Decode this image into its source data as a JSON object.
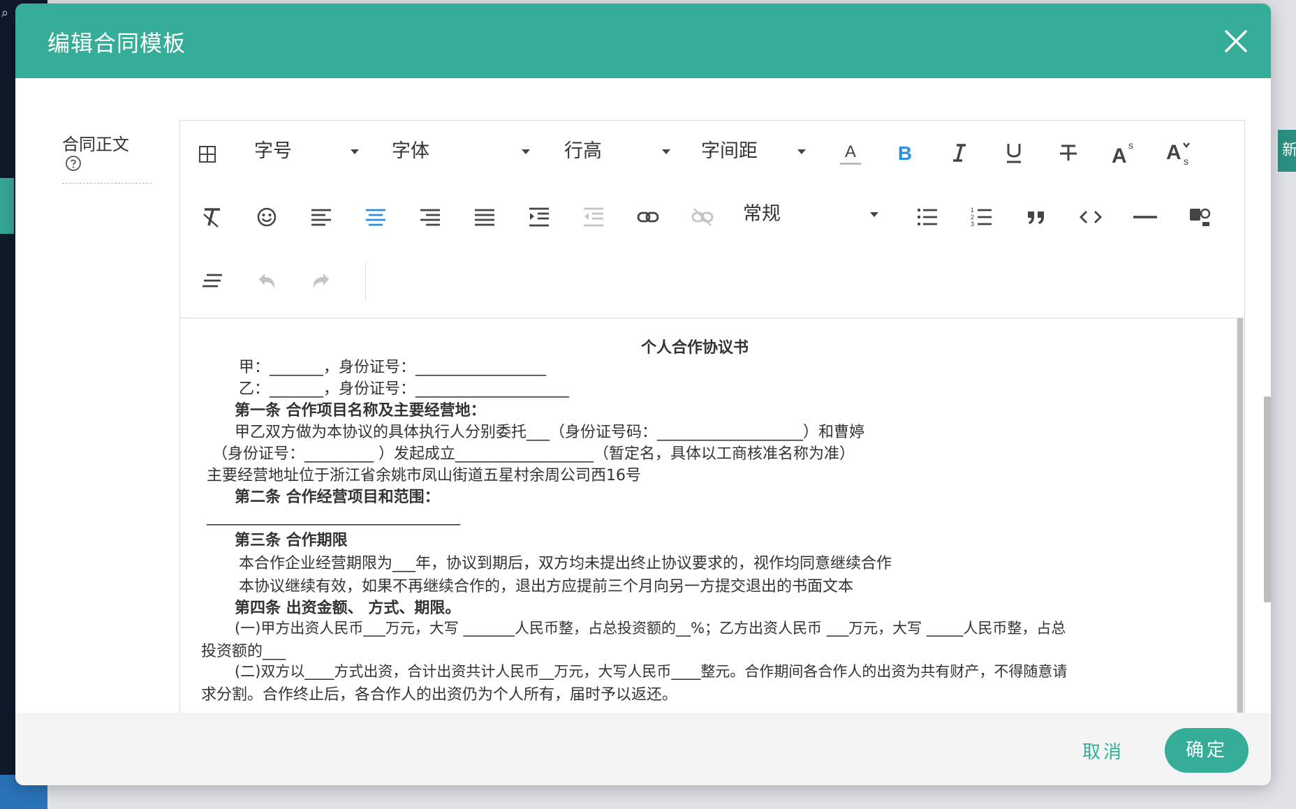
{
  "background": {
    "side_button_text": "新"
  },
  "modal": {
    "title": "编辑合同模板",
    "field_label": "合同正文",
    "toolbar": {
      "font_size": "字号",
      "font_family": "字体",
      "line_height": "行高",
      "letter_spacing": "字间距",
      "paragraph_style": "常规"
    },
    "document": {
      "title": "个人合作协议书",
      "lines": [
        "甲：_______，身份证号：_________________",
        "乙：_______，身份证号：____________________",
        "第一条 合作项目名称及主要经营地：",
        "甲乙双方做为本协议的具体执行人分别委托___（身份证号码：___________________）和曹婷",
        "（身份证号：_________ ）发起成立__________________（暂定名，具体以工商核准名称为准）",
        "主要经营地址位于浙江省余姚市凤山街道五星村余周公司西16号",
        "第二条 合作经营项目和范围：",
        "_________________________________",
        "第三条 合作期限",
        "本合作企业经营期限为___年，协议到期后，双方均未提出终止协议要求的，视作均同意继续合作",
        "本协议继续有效，如果不再继续合作的，退出方应提前三个月向另一方提交退出的书面文本",
        "第四条 出资金额、 方式、期限。",
        "(一)甲方出资人民币___万元，大写 _______人民币整，占总投资额的__%；乙方出资人民币 ___万元，大写 _____人民币整，占总",
        "投资额的___",
        "(二)双方以____方式出资，合计出资共计人民币__万元，大写人民币____整元。合作期间各合作人的出资为共有财产，不得随意请",
        "求分割。合作终止后，各合作人的出资仍为个人所有，届时予以返还。"
      ]
    },
    "footer": {
      "cancel_label": "取消",
      "ok_label": "确定"
    }
  },
  "colors": {
    "primary": "#36ad98",
    "active_icon": "#2d8de0",
    "disabled_icon": "#c4c4c4"
  },
  "icons": [
    "table-icon",
    "text-color-icon",
    "bold-icon",
    "italic-icon",
    "underline-icon",
    "strikethrough-icon",
    "superscript-icon",
    "subscript-icon",
    "clear-format-icon",
    "emoji-icon",
    "align-left-icon",
    "align-center-icon",
    "align-right-icon",
    "justify-icon",
    "indent-icon",
    "outdent-icon",
    "link-icon",
    "unlink-icon",
    "bullet-list-icon",
    "numbered-list-icon",
    "blockquote-icon",
    "code-icon",
    "horizontal-rule-icon",
    "format-painter-icon",
    "wrap-icon",
    "undo-icon",
    "redo-icon"
  ]
}
